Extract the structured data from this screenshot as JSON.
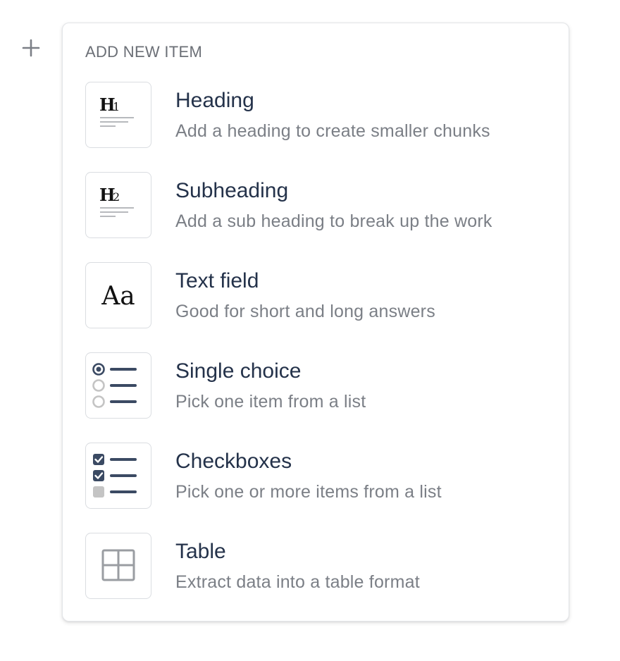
{
  "plus": {
    "icon": "plus-icon"
  },
  "menu": {
    "header": "ADD NEW ITEM",
    "items": [
      {
        "title": "Heading",
        "description": "Add a heading to create smaller chunks",
        "icon": "heading-1-icon",
        "glyph": "H1"
      },
      {
        "title": "Subheading",
        "description": "Add a sub heading to break up the work",
        "icon": "heading-2-icon",
        "glyph": "H2"
      },
      {
        "title": "Text field",
        "description": "Good for short and long answers",
        "icon": "text-field-icon",
        "glyph": "Aa"
      },
      {
        "title": "Single choice",
        "description": "Pick one item from a list",
        "icon": "radio-list-icon"
      },
      {
        "title": "Checkboxes",
        "description": "Pick one or more items from a list",
        "icon": "checkbox-list-icon"
      },
      {
        "title": "Table",
        "description": "Extract data into a table format",
        "icon": "table-icon"
      }
    ]
  },
  "colors": {
    "title": "#24324a",
    "description": "#7b7f86",
    "accent": "#3b4a63",
    "icon_gray": "#c4c4c4",
    "border": "#dadde1"
  }
}
